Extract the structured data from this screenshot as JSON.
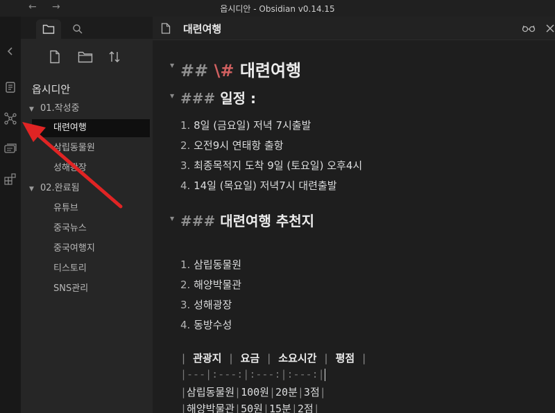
{
  "window": {
    "title": "옵시디안 - Obsidian v0.14.15",
    "back_label": "←",
    "forward_label": "→"
  },
  "sidebar": {
    "vault_name": "옵시디안",
    "tree": [
      {
        "type": "folder",
        "label": "01.작성중",
        "expanded": true
      },
      {
        "type": "file",
        "label": "대련여행",
        "selected": true
      },
      {
        "type": "file",
        "label": "삼립동물원"
      },
      {
        "type": "file",
        "label": "성해광장"
      },
      {
        "type": "folder",
        "label": "02.완료됨",
        "expanded": true
      },
      {
        "type": "file",
        "label": "유튜브"
      },
      {
        "type": "file",
        "label": "중국뉴스"
      },
      {
        "type": "file",
        "label": "중국여행지"
      },
      {
        "type": "file",
        "label": "티스토리"
      },
      {
        "type": "file",
        "label": "SNS관리"
      }
    ]
  },
  "editor": {
    "tab_title": "대련여행",
    "h2": {
      "hashes": "##",
      "escape": "\\#",
      "text": "대련여행"
    },
    "schedule": {
      "hashes": "###",
      "heading": "일정 :",
      "items": [
        {
          "num": "1.",
          "text": "8일 (금요일) 저녁 7시출발"
        },
        {
          "num": "2.",
          "text": "오전9시 연태항 출항"
        },
        {
          "num": "3.",
          "text": "최종목적지 도착 9일 (토요일) 오후4시"
        },
        {
          "num": "4.",
          "text": "14일 (목요일) 저녁7시 대련출발"
        }
      ]
    },
    "recommend": {
      "hashes": "###",
      "heading": "대련여행 추천지",
      "items": [
        {
          "num": "1.",
          "text": "삼립동물원"
        },
        {
          "num": "2.",
          "text": "해양박물관"
        },
        {
          "num": "3.",
          "text": "성해광장"
        },
        {
          "num": "4.",
          "text": "동방수성"
        }
      ]
    },
    "table": {
      "headers": [
        "관광지",
        "요금",
        "소요시간",
        "평점"
      ],
      "separator": "|---|:---:|:---:|:---:|",
      "rows": [
        [
          "삼립동물원",
          "100원",
          "20분",
          "3점"
        ],
        [
          "해양박물관",
          "50원",
          "15분",
          "2점"
        ]
      ]
    }
  },
  "colors": {
    "background": "#1e1e1e",
    "sidebar": "#262626",
    "ribbon": "#181818",
    "selected_item": "#0f0f0f",
    "annotation_arrow": "#e02424",
    "escape_mark": "#d06060"
  }
}
